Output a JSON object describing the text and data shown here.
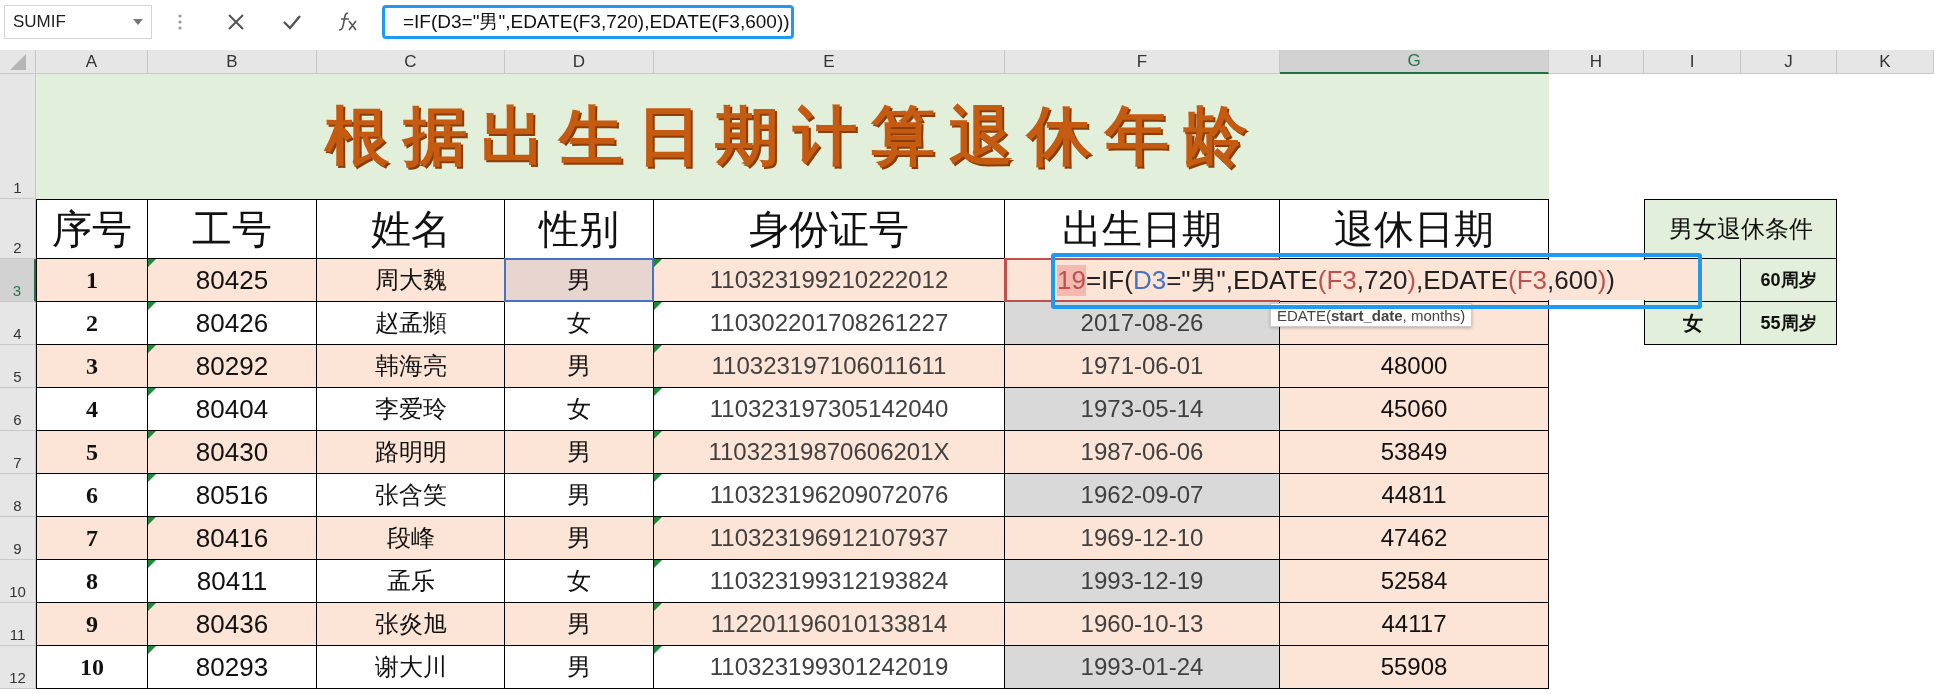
{
  "formula_bar": {
    "name_box": "SUMIF",
    "formula": "=IF(D3=\"男\",EDATE(F3,720),EDATE(F3,600))"
  },
  "columns": [
    {
      "label": "A",
      "selected": false
    },
    {
      "label": "B",
      "selected": false
    },
    {
      "label": "C",
      "selected": false
    },
    {
      "label": "D",
      "selected": false
    },
    {
      "label": "E",
      "selected": false
    },
    {
      "label": "F",
      "selected": false
    },
    {
      "label": "G",
      "selected": true
    },
    {
      "label": "H",
      "selected": false
    },
    {
      "label": "I",
      "selected": false
    },
    {
      "label": "J",
      "selected": false
    },
    {
      "label": "K",
      "selected": false
    }
  ],
  "row_numbers": [
    {
      "label": "1",
      "selected": false
    },
    {
      "label": "2",
      "selected": false
    },
    {
      "label": "3",
      "selected": true
    },
    {
      "label": "4",
      "selected": false
    },
    {
      "label": "5",
      "selected": false
    },
    {
      "label": "6",
      "selected": false
    },
    {
      "label": "7",
      "selected": false
    },
    {
      "label": "8",
      "selected": false
    },
    {
      "label": "9",
      "selected": false
    },
    {
      "label": "10",
      "selected": false
    },
    {
      "label": "11",
      "selected": false
    },
    {
      "label": "12",
      "selected": false
    }
  ],
  "title": "根据出生日期计算退休年龄",
  "headers": [
    "序号",
    "工号",
    "姓名",
    "性别",
    "身份证号",
    "出生日期",
    "退休日期"
  ],
  "records": [
    {
      "no": "1",
      "id": "80425",
      "name": "周大魏",
      "gender": "男",
      "id_card": "110323199210222012",
      "flagged": true,
      "gender_highlighted": true,
      "birth_highlighted": true,
      "editor": {
        "prefix": "19",
        "parts": [
          {
            "text": "=IF(",
            "kind": "text"
          },
          {
            "text": "D3",
            "kind": "ref",
            "color": "#4472c4"
          },
          {
            "text": "=\"男\",EDATE",
            "kind": "text"
          },
          {
            "text": "(F3",
            "kind": "ref",
            "color": "#c0504d"
          },
          {
            "text": ",720",
            "kind": "text"
          },
          {
            "text": ")",
            "kind": "ref",
            "color": "#c0504d"
          },
          {
            "text": ",EDATE",
            "kind": "text"
          },
          {
            "text": "(F3",
            "kind": "ref",
            "color": "#c0504d"
          },
          {
            "text": ",600",
            "kind": "text"
          },
          {
            "text": ")",
            "kind": "ref",
            "color": "#c0504d"
          },
          {
            "text": ")",
            "kind": "text"
          }
        ],
        "tooltip": "EDATE(**start_date**, months)"
      }
    },
    {
      "no": "2",
      "id": "80426",
      "name": "赵孟頫",
      "gender": "女",
      "id_card": "110302201708261227",
      "birth_date": "2017-08-26",
      "flagged": true,
      "gender_highlighted": false,
      "birth_highlighted": false,
      "birth_shaded": true
    },
    {
      "no": "3",
      "id": "80292",
      "name": "韩海亮",
      "gender": "男",
      "id_card": "110323197106011611",
      "birth_date": "1971-06-01",
      "retire_date": "48000",
      "flagged": true,
      "gender_highlighted": false,
      "birth_highlighted": false,
      "birth_shaded": false
    },
    {
      "no": "4",
      "id": "80404",
      "name": "李爱玲",
      "gender": "女",
      "id_card": "110323197305142040",
      "birth_date": "1973-05-14",
      "retire_date": "45060",
      "flagged": true,
      "gender_highlighted": false,
      "birth_highlighted": false,
      "birth_shaded": true
    },
    {
      "no": "5",
      "id": "80430",
      "name": "路明明",
      "gender": "男",
      "id_card": "11032319870606201X",
      "birth_date": "1987-06-06",
      "retire_date": "53849",
      "flagged": true,
      "gender_highlighted": false,
      "birth_highlighted": false,
      "birth_shaded": false
    },
    {
      "no": "6",
      "id": "80516",
      "name": "张含笑",
      "gender": "男",
      "id_card": "110323196209072076",
      "birth_date": "1962-09-07",
      "retire_date": "44811",
      "flagged": true,
      "gender_highlighted": false,
      "birth_highlighted": false,
      "birth_shaded": true
    },
    {
      "no": "7",
      "id": "80416",
      "name": "段峰",
      "gender": "男",
      "id_card": "110323196912107937",
      "birth_date": "1969-12-10",
      "retire_date": "47462",
      "flagged": true,
      "gender_highlighted": false,
      "birth_highlighted": false,
      "birth_shaded": false
    },
    {
      "no": "8",
      "id": "80411",
      "name": "孟乐",
      "gender": "女",
      "id_card": "110323199312193824",
      "birth_date": "1993-12-19",
      "retire_date": "52584",
      "flagged": true,
      "gender_highlighted": false,
      "birth_highlighted": false,
      "birth_shaded": true
    },
    {
      "no": "9",
      "id": "80436",
      "name": "张炎旭",
      "gender": "男",
      "id_card": "112201196010133814",
      "birth_date": "1960-10-13",
      "retire_date": "44117",
      "flagged": true,
      "gender_highlighted": false,
      "birth_highlighted": false,
      "birth_shaded": false
    },
    {
      "no": "10",
      "id": "80293",
      "name": "谢大川",
      "gender": "男",
      "id_card": "110323199301242019",
      "birth_date": "1993-01-24",
      "retire_date": "55908",
      "flagged": true,
      "gender_highlighted": false,
      "birth_highlighted": false,
      "birth_shaded": true
    }
  ],
  "conditions": {
    "title": "男女退休条件",
    "rows": [
      {
        "age": "60周岁"
      },
      {
        "gender": "女",
        "age": "55周岁"
      }
    ]
  }
}
